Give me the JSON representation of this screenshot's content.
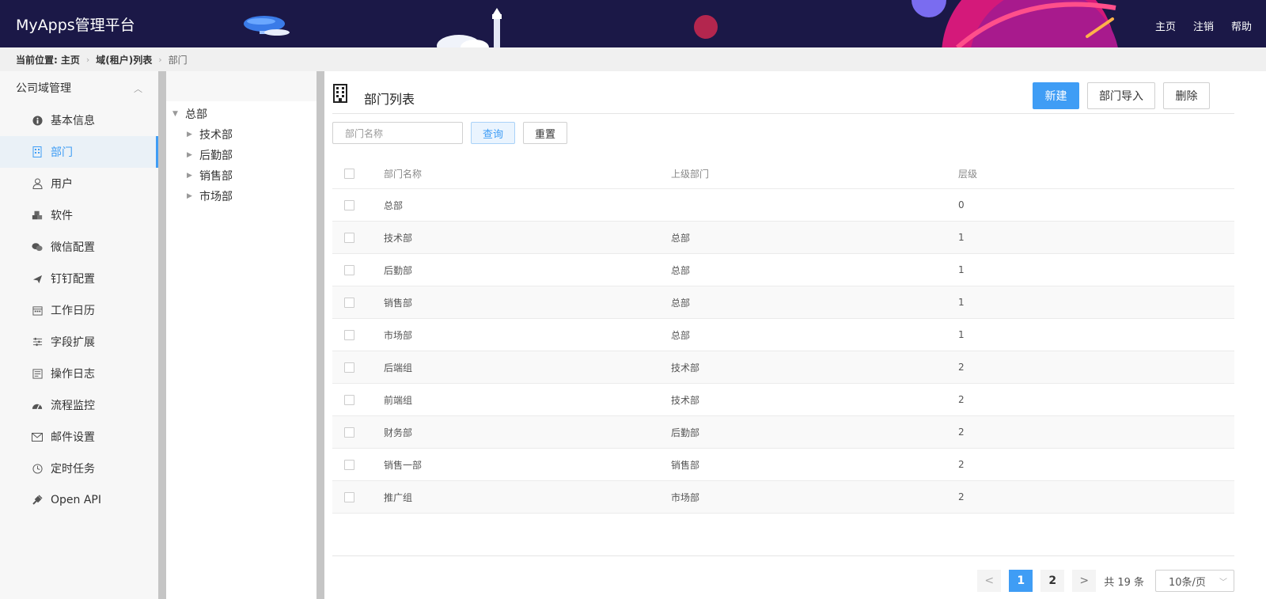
{
  "header": {
    "brand": "MyApps管理平台",
    "links": [
      "主页",
      "注销",
      "帮助"
    ]
  },
  "breadcrumb": {
    "lead": "当前位置:",
    "items": [
      "主页",
      "域(租户)列表",
      "部门"
    ]
  },
  "sidebar": {
    "title": "公司域管理",
    "items": [
      {
        "label": "基本信息",
        "icon": "info-icon"
      },
      {
        "label": "部门",
        "icon": "building-icon",
        "active": true
      },
      {
        "label": "用户",
        "icon": "user-icon"
      },
      {
        "label": "软件",
        "icon": "cubes-icon"
      },
      {
        "label": "微信配置",
        "icon": "wechat-icon"
      },
      {
        "label": "钉钉配置",
        "icon": "plane-icon"
      },
      {
        "label": "工作日历",
        "icon": "calendar-icon"
      },
      {
        "label": "字段扩展",
        "icon": "sliders-icon"
      },
      {
        "label": "操作日志",
        "icon": "log-icon"
      },
      {
        "label": "流程监控",
        "icon": "dashboard-icon"
      },
      {
        "label": "邮件设置",
        "icon": "mail-icon"
      },
      {
        "label": "定时任务",
        "icon": "clock-icon"
      },
      {
        "label": "Open API",
        "icon": "plug-icon"
      }
    ]
  },
  "tree": {
    "root": "总部",
    "children": [
      "技术部",
      "后勤部",
      "销售部",
      "市场部"
    ]
  },
  "main": {
    "title": "部门列表",
    "buttons": {
      "new": "新建",
      "import": "部门导入",
      "delete": "删除"
    },
    "search": {
      "placeholder": "部门名称",
      "query": "查询",
      "reset": "重置"
    },
    "table": {
      "headers": [
        "部门名称",
        "上级部门",
        "层级"
      ],
      "rows": [
        [
          "总部",
          "",
          "0"
        ],
        [
          "技术部",
          "总部",
          "1"
        ],
        [
          "后勤部",
          "总部",
          "1"
        ],
        [
          "销售部",
          "总部",
          "1"
        ],
        [
          "市场部",
          "总部",
          "1"
        ],
        [
          "后端组",
          "技术部",
          "2"
        ],
        [
          "前端组",
          "技术部",
          "2"
        ],
        [
          "财务部",
          "后勤部",
          "2"
        ],
        [
          "销售一部",
          "销售部",
          "2"
        ],
        [
          "推广组",
          "市场部",
          "2"
        ]
      ]
    },
    "pager": {
      "prev": "<",
      "next": ">",
      "pages": [
        "1",
        "2"
      ],
      "current": "1",
      "total": "共 19 条",
      "size": "10条/页"
    }
  },
  "colors": {
    "header_bg": "#1b1847",
    "accent": "#3f9df5",
    "divider": "#c5c5c5"
  }
}
